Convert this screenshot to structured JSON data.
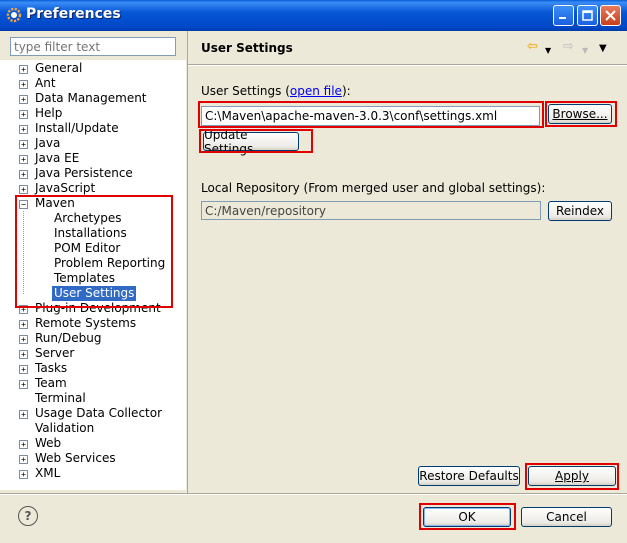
{
  "window": {
    "title": "Preferences"
  },
  "filter": {
    "placeholder": "type filter text"
  },
  "tree": {
    "items": [
      {
        "label": "General",
        "expandable": true
      },
      {
        "label": "Ant",
        "expandable": true
      },
      {
        "label": "Data Management",
        "expandable": true
      },
      {
        "label": "Help",
        "expandable": true
      },
      {
        "label": "Install/Update",
        "expandable": true
      },
      {
        "label": "Java",
        "expandable": true
      },
      {
        "label": "Java EE",
        "expandable": true
      },
      {
        "label": "Java Persistence",
        "expandable": true
      },
      {
        "label": "JavaScript",
        "expandable": true
      },
      {
        "label": "Maven",
        "expandable": true,
        "expanded": true
      },
      {
        "label": "Archetypes",
        "child": true
      },
      {
        "label": "Installations",
        "child": true
      },
      {
        "label": "POM Editor",
        "child": true
      },
      {
        "label": "Problem Reporting",
        "child": true
      },
      {
        "label": "Templates",
        "child": true
      },
      {
        "label": "User Settings",
        "child": true,
        "selected": true
      },
      {
        "label": "Plug-in Development",
        "expandable": true
      },
      {
        "label": "Remote Systems",
        "expandable": true
      },
      {
        "label": "Run/Debug",
        "expandable": true
      },
      {
        "label": "Server",
        "expandable": true
      },
      {
        "label": "Tasks",
        "expandable": true
      },
      {
        "label": "Team",
        "expandable": true
      },
      {
        "label": "Terminal",
        "expandable": false
      },
      {
        "label": "Usage Data Collector",
        "expandable": true
      },
      {
        "label": "Validation",
        "expandable": false
      },
      {
        "label": "Web",
        "expandable": true
      },
      {
        "label": "Web Services",
        "expandable": true
      },
      {
        "label": "XML",
        "expandable": true
      }
    ]
  },
  "page": {
    "title": "User Settings",
    "user_settings_label_pre": "User Settings (",
    "user_settings_label_link": "open file",
    "user_settings_label_post": "):",
    "user_settings_value": "C:\\Maven\\apache-maven-3.0.3\\conf\\settings.xml",
    "browse_label": "Browse...",
    "update_label": "Update Settings",
    "local_repo_label": "Local Repository (From merged user and global settings):",
    "local_repo_value": "C:/Maven/repository",
    "reindex_label": "Reindex",
    "restore_defaults_label": "Restore Defaults",
    "apply_label": "Apply"
  },
  "footer": {
    "help_glyph": "?",
    "ok_label": "OK",
    "cancel_label": "Cancel"
  },
  "colors": {
    "highlight": "#e00000",
    "selection": "#316ac5",
    "title_blue": "#0a5fd8"
  }
}
